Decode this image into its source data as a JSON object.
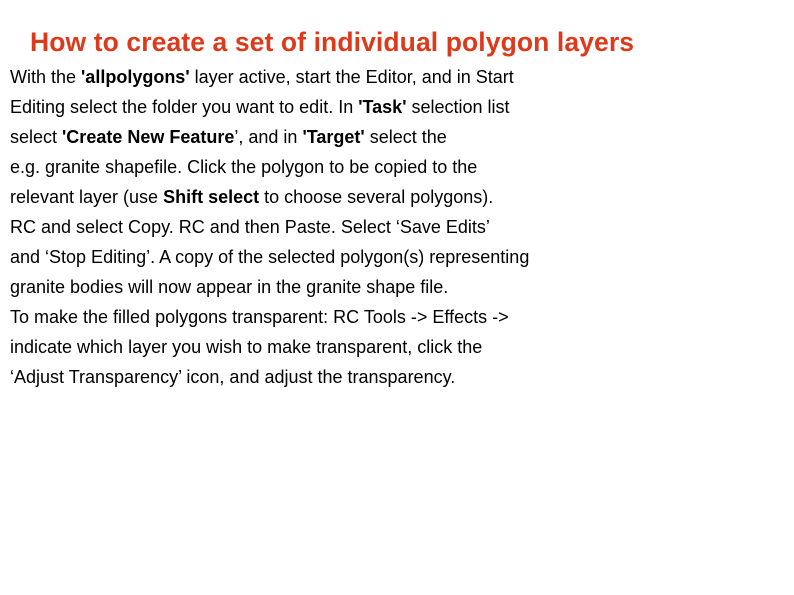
{
  "slide": {
    "title": "How to create a set of individual polygon layers",
    "title_color": "#dd3a1c",
    "background_color": "#ffffff",
    "body_color": "#000000",
    "lines": [
      {
        "id": "line-1",
        "runs": [
          {
            "text": "With the ",
            "bold": false
          },
          {
            "text": "'allpolygons'",
            "bold": true
          },
          {
            "text": " layer active, start the Editor, and in Start",
            "bold": false
          }
        ]
      },
      {
        "id": "line-2",
        "runs": [
          {
            "text": "Editing select the folder you want to edit. In ",
            "bold": false
          },
          {
            "text": "'Task'",
            "bold": true
          },
          {
            "text": " selection list",
            "bold": false
          }
        ]
      },
      {
        "id": "line-3",
        "runs": [
          {
            "text": "select ",
            "bold": false
          },
          {
            "text": "'Create New Feature",
            "bold": true
          },
          {
            "text": "’, and in ",
            "bold": false
          },
          {
            "text": "'Target'",
            "bold": true
          },
          {
            "text": " select the",
            "bold": false
          }
        ]
      },
      {
        "id": "line-4",
        "runs": [
          {
            "text": "e.g. granite shapefile. Click the polygon to be copied to the",
            "bold": false
          }
        ]
      },
      {
        "id": "line-5",
        "runs": [
          {
            "text": "relevant layer (use ",
            "bold": false
          },
          {
            "text": "Shift select",
            "bold": true
          },
          {
            "text": " to choose several polygons).",
            "bold": false
          }
        ]
      },
      {
        "id": "line-6",
        "runs": [
          {
            "text": "RC and select Copy. RC and then Paste. Select ‘Save Edits’",
            "bold": false
          }
        ]
      },
      {
        "id": "line-7",
        "runs": [
          {
            "text": "and ‘Stop Editing’. A copy of the selected polygon(s) representing",
            "bold": false
          }
        ]
      },
      {
        "id": "line-8",
        "runs": [
          {
            "text": "granite bodies will now appear in the granite shape file.",
            "bold": false
          }
        ]
      },
      {
        "id": "line-9",
        "runs": [
          {
            "text": "To make the filled polygons transparent: RC Tools -> Effects ->",
            "bold": false
          }
        ]
      },
      {
        "id": "line-10",
        "runs": [
          {
            "text": "indicate which layer you wish to make transparent, click the",
            "bold": false
          }
        ]
      },
      {
        "id": "line-11",
        "runs": [
          {
            "text": "‘Adjust Transparency’ icon, and adjust the transparency.",
            "bold": false
          }
        ]
      }
    ]
  }
}
